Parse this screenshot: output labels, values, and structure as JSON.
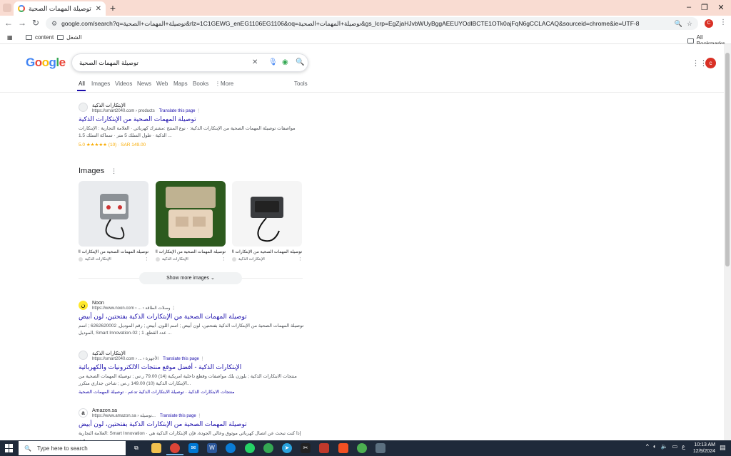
{
  "browser": {
    "tab_title": "توصيلة المهمات الصحية - Search",
    "new_tab": "+",
    "url": "google.com/search?q=توصيلة+المهمات+الصحية&rlz=1C1GEWG_enEG1106EG1106&oq=توصيلة+المهمات+الصحية&gs_lcrp=EgZjaHJvbWUyBggAEEUYOdIBCTE1OTk0ajFqN6gCCLACAQ&sourceid=chrome&ie=UTF-8",
    "profile_initial": "C",
    "bookmarks": [
      "content",
      "الشغل"
    ],
    "all_bookmarks": "All Bookmarks"
  },
  "google": {
    "logo": "Google",
    "query": "توصيلة المهمات الصحية",
    "avatar_initial": "c",
    "tabs": [
      "All",
      "Images",
      "Videos",
      "News",
      "Web",
      "Maps",
      "Books",
      "More"
    ],
    "tools": "Tools"
  },
  "results": [
    {
      "site": "الإبتكارات الذكية",
      "url": "https://smart2040.com › products",
      "translate": "Translate this page",
      "title": "توصيلة المهمات الصحية من الإبتكارات الذكية",
      "snippet": "مواصفات توصيلة المهمات الصحية من الإبتكارات الذكية: · نوع المنتج :مشترك كهربائي · العلامة التجارية : الإبتكارات الذكية · طول السلك 5 متر · سماكة السلك 1.5 ...",
      "rating": "5.0 ★★★★★ (10) · SAR 149.00"
    },
    {
      "site": "Noon",
      "url": "https://www.noon.com › ... › وصلات الطاقة",
      "title": "توصيلة المهمات الصحية من الإبتكارات الذكية بفتحتين، لون أبيض",
      "snippet": "توصيلة المهمات الصحية من الإبتكارات الذكية بفتحتين، لون أبيض ; اسم اللون, أبيض ; رقم الموديل, 6262620002 ; اسم الموديل, Smart Innovation-02 ; عدد القطع, 1 ..."
    },
    {
      "site": "الإبتكارات الذكية",
      "url": "https://smart2040.com › ... › الأجهزة",
      "translate": "Translate this page",
      "title": "الإبتكارات الذكية - أفضل موقع منتجات الالكترونيات والكهربائية",
      "snippet": "منتجات الابتكارات الذكية ; بلوزن بلك مواصفات وقطع داخلية امريكية (14) 79.00 ر.س ; توصيلة المهمات الصحية من الإبتكارات الذكية (10) 149.00 ر.س ; شاحن جداري متكرر...",
      "sitelinks": "منتجات الابتكارات الذكية · توصيلة الابتكارات الذكية تدعم · توصيلة المهمات الصحية"
    },
    {
      "site": "Amazon.sa",
      "url": "https://www.amazon.sa › توصيلة...",
      "translate": "Translate this page",
      "title": "توصيلة المهمات الصحية من الإبتكارات الذكية بفتحتين، لون أبيض",
      "snippet": "العلامة التجارية: Smart Innovation · إذا كنت تبحث عن اتصال كهربائي موثوق وعالي الجودة، فإن الإبتكارات الذكية هي وقت..."
    }
  ],
  "images_section": {
    "heading": "Images",
    "items": [
      {
        "caption": "توصيلة المهمات الصحية من الإبتكارات الذ...",
        "source": "الإبتكارات الذكية"
      },
      {
        "caption": "توصيلة المهمات الصحية من الإبتكارات الذ...",
        "source": "الإبتكارات الذكية"
      },
      {
        "caption": "توصيلة المهمات الصحية من الإبتكارات الذ...",
        "source": "الإبتكارات الذكية"
      }
    ],
    "show_more": "Show more images"
  },
  "taskbar": {
    "search_placeholder": "Type here to search",
    "lang": "ع",
    "time": "10:13 AM",
    "date": "12/9/2024"
  }
}
